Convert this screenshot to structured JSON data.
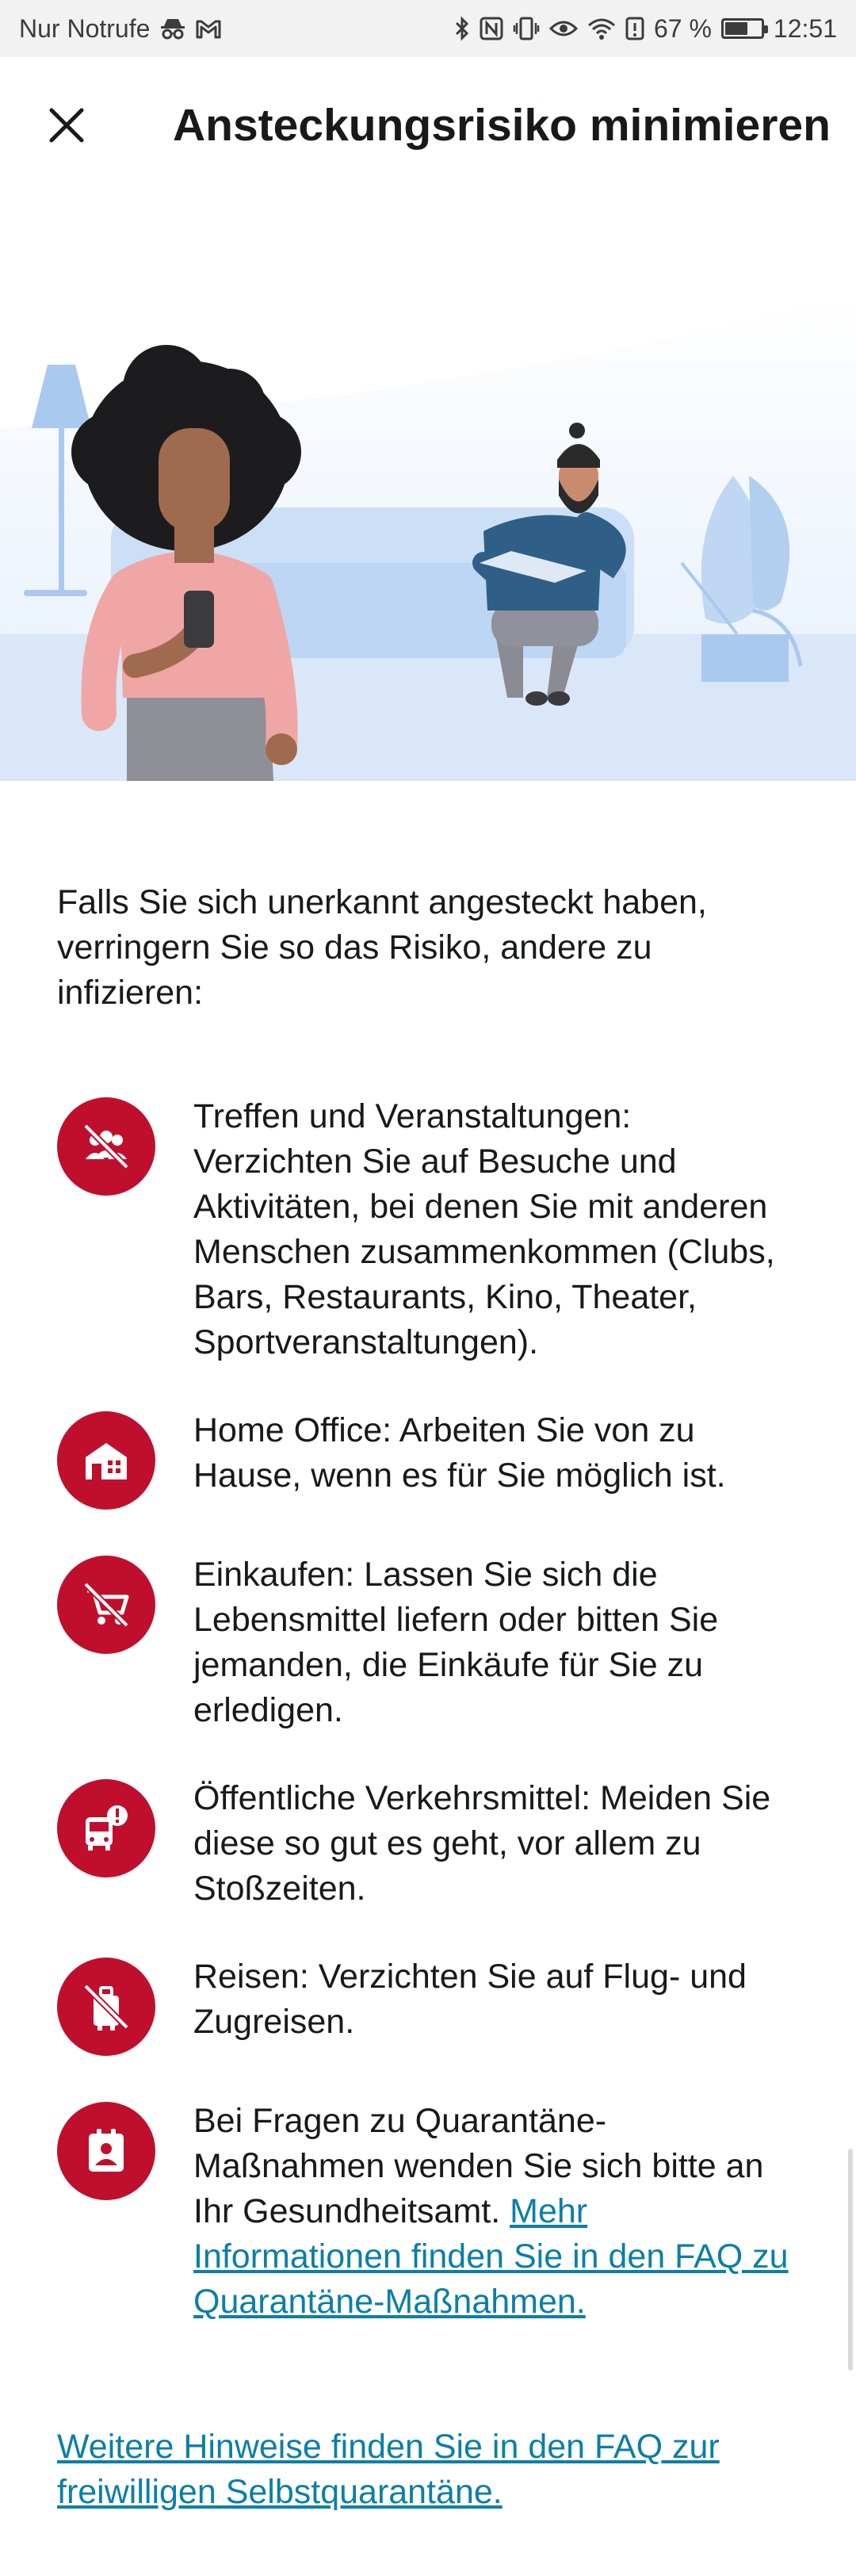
{
  "status_bar": {
    "carrier": "Nur Notrufe",
    "battery": "67 %",
    "battery_level": 0.67,
    "time": "12:51",
    "icons": [
      "incognito-icon",
      "gmail-icon",
      "bluetooth-icon",
      "nfc-icon",
      "vibrate-icon",
      "eye-icon",
      "wifi-icon",
      "alert-icon",
      "battery-icon"
    ]
  },
  "header": {
    "title": "Ansteckungsrisiko minimieren",
    "close_icon": "close-icon"
  },
  "hero": {
    "illustration": "people-at-home-illustration"
  },
  "intro": "Falls Sie sich unerkannt angesteckt haben, verringern Sie so das Risiko, andere zu infizieren:",
  "rules": [
    {
      "icon": "no-gatherings-icon",
      "text": "Treffen und Veranstaltungen: Verzichten Sie auf Besuche und Aktivitäten, bei denen Sie mit anderen Menschen zusammenkommen (Clubs, Bars, Restaurants, Kino, Theater, Sportveranstaltungen)."
    },
    {
      "icon": "home-office-icon",
      "text": "Home Office: Arbeiten Sie von zu Hause, wenn es für Sie möglich ist."
    },
    {
      "icon": "no-shopping-cart-icon",
      "text": "Einkaufen: Lassen Sie sich die Lebensmittel liefern oder bitten Sie jemanden, die Einkäufe für Sie zu erledigen."
    },
    {
      "icon": "public-transport-alert-icon",
      "text": "Öffentliche Verkehrsmittel: Meiden Sie diese so gut es geht, vor allem zu Stoßzeiten."
    },
    {
      "icon": "no-travel-luggage-icon",
      "text": "Reisen: Verzichten Sie auf Flug- und Zugreisen."
    },
    {
      "icon": "contact-badge-icon",
      "text": "Bei Fragen zu Quarantäne-Maßnahmen wenden Sie sich bitte an Ihr Gesundheitsamt. ",
      "link": "Mehr Informationen finden Sie in den FAQ zu Quarantäne-Maßnahmen."
    }
  ],
  "footer_link": "Weitere Hinweise finden Sie in den FAQ zur freiwilligen Selbstquarantäne.",
  "colors": {
    "accent": "#c00f2d",
    "link": "#0b7fa8",
    "text": "#17191a",
    "hero_bg": "#e8f1fc"
  }
}
